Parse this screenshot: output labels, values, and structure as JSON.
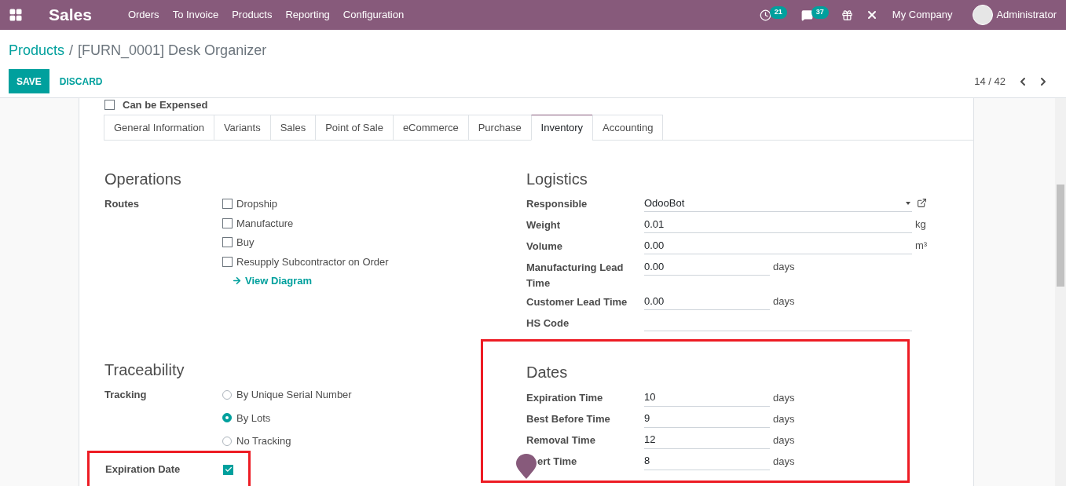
{
  "navbar": {
    "app": "Sales",
    "menu": [
      "Orders",
      "To Invoice",
      "Products",
      "Reporting",
      "Configuration"
    ],
    "activity_count": "21",
    "message_count": "37",
    "company": "My Company",
    "user": "Administrator"
  },
  "breadcrumb": {
    "parent": "Products",
    "separator": "/",
    "current": "[FURN_0001] Desk Organizer"
  },
  "buttons": {
    "save": "SAVE",
    "discard": "DISCARD"
  },
  "pager": "14 / 42",
  "can_be_expensed": {
    "label": "Can be Expensed",
    "checked": false
  },
  "tabs": [
    {
      "label": "General Information",
      "selected": false
    },
    {
      "label": "Variants",
      "selected": false
    },
    {
      "label": "Sales",
      "selected": false
    },
    {
      "label": "Point of Sale",
      "selected": false
    },
    {
      "label": "eCommerce",
      "selected": false
    },
    {
      "label": "Purchase",
      "selected": false
    },
    {
      "label": "Inventory",
      "selected": true
    },
    {
      "label": "Accounting",
      "selected": false
    }
  ],
  "operations": {
    "title": "Operations",
    "routes_label": "Routes",
    "routes": [
      {
        "label": "Dropship",
        "checked": false
      },
      {
        "label": "Manufacture",
        "checked": false
      },
      {
        "label": "Buy",
        "checked": false
      },
      {
        "label": "Resupply Subcontractor on Order",
        "checked": false
      }
    ],
    "view_diagram": "View Diagram"
  },
  "logistics": {
    "title": "Logistics",
    "fields": [
      {
        "kind": "select",
        "label": "Responsible",
        "value": "OdooBot"
      },
      {
        "kind": "wide",
        "label": "Weight",
        "value": "0.01",
        "unit": "kg"
      },
      {
        "kind": "wide",
        "label": "Volume",
        "value": "0.00",
        "unit": "m³"
      },
      {
        "kind": "short",
        "label": "Manufacturing Lead Time",
        "value": "0.00",
        "unit": "days"
      },
      {
        "kind": "short",
        "label": "Customer Lead Time",
        "value": "0.00",
        "unit": "days"
      },
      {
        "kind": "wide",
        "label": "HS Code"
      }
    ]
  },
  "traceability": {
    "title": "Traceability",
    "tracking_label": "Tracking",
    "options": [
      {
        "label": "By Unique Serial Number",
        "selected": false
      },
      {
        "label": "By Lots",
        "selected": true
      },
      {
        "label": "No Tracking",
        "selected": false
      }
    ],
    "expiration_label": "Expiration Date",
    "expiration_checked": true,
    "highlighted": true
  },
  "dates": {
    "title": "Dates",
    "highlighted": true,
    "fields": [
      {
        "label": "Expiration Time",
        "value": "10",
        "unit": "days"
      },
      {
        "label": "Best Before Time",
        "value": "9",
        "unit": "days"
      },
      {
        "label": "Removal Time",
        "value": "12",
        "unit": "days"
      },
      {
        "label": "ert Time",
        "value": "8",
        "unit": "days",
        "marker": true
      }
    ]
  }
}
